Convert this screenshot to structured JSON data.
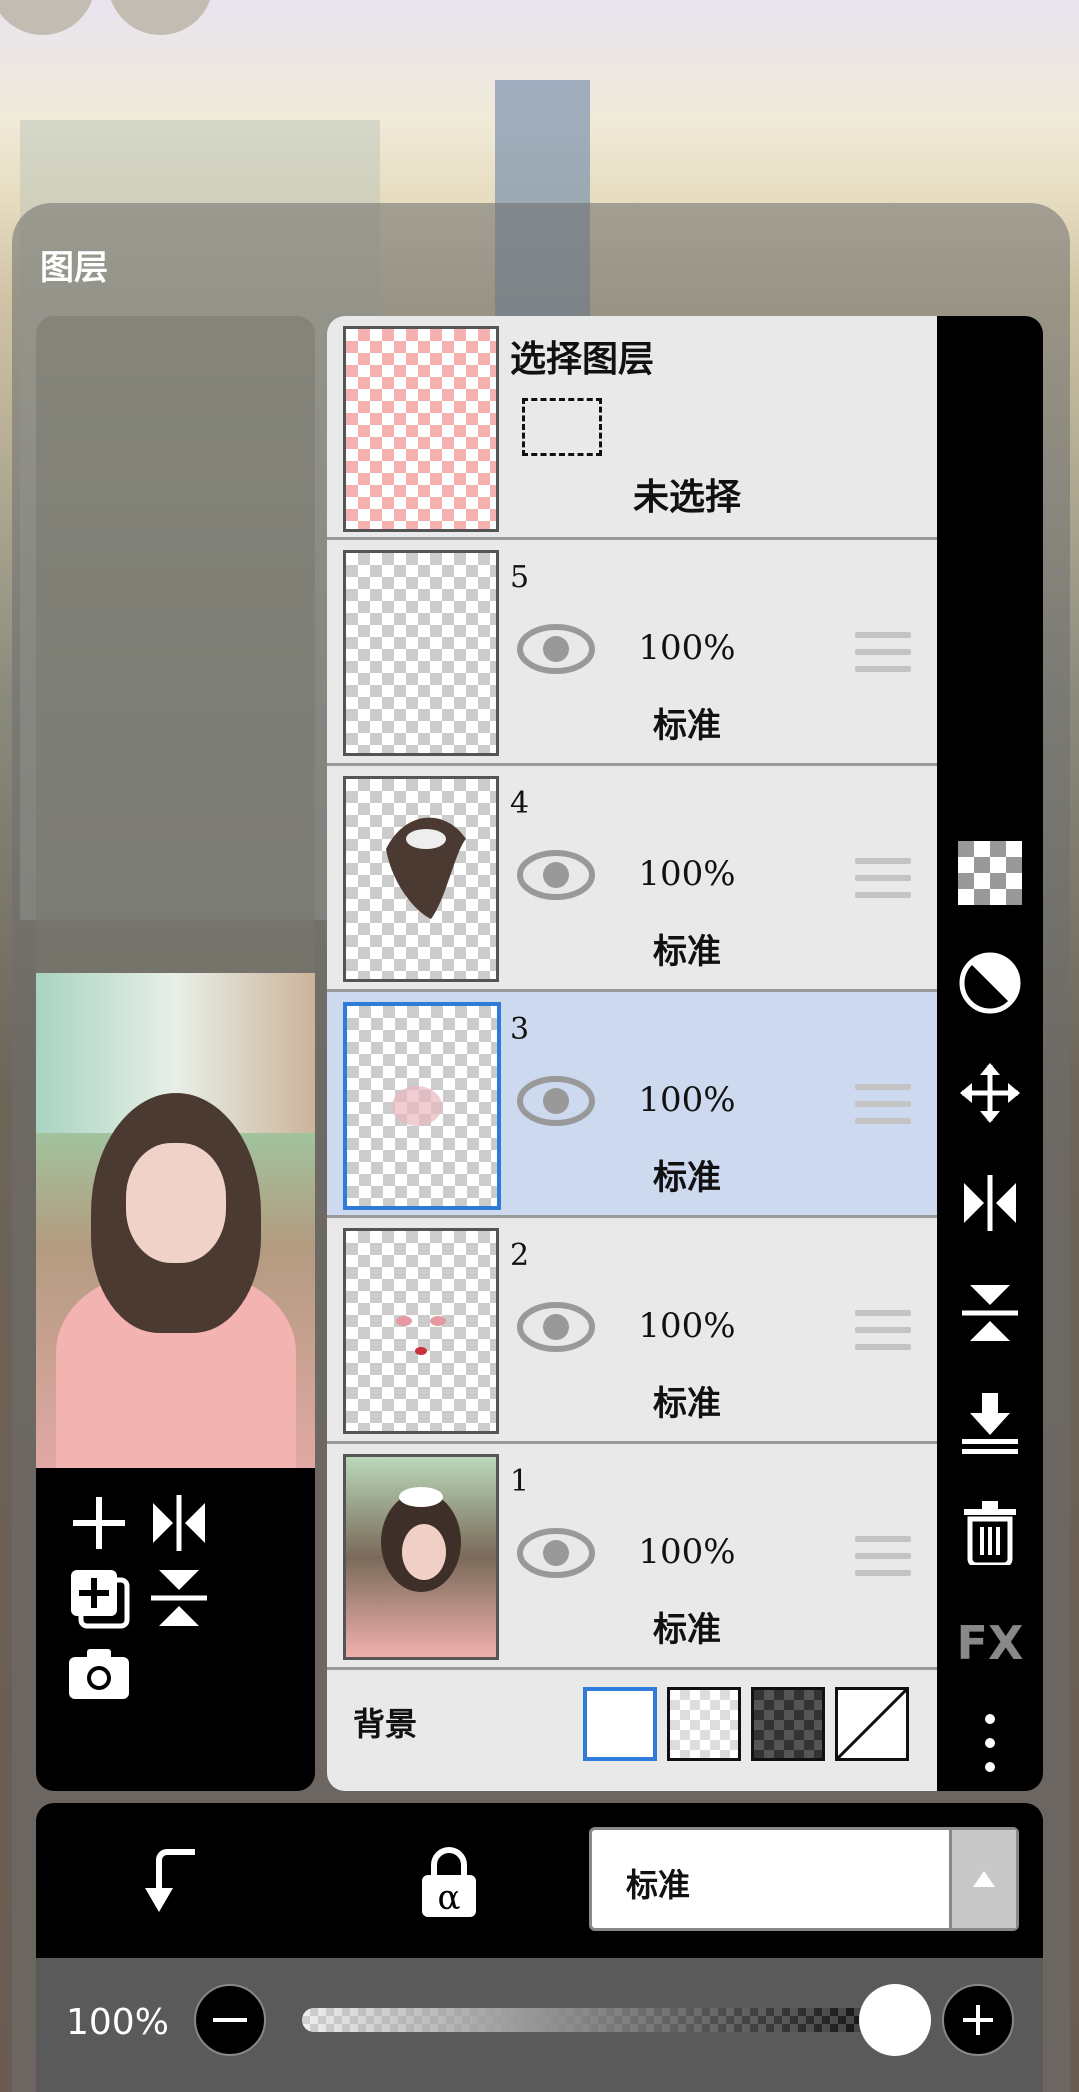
{
  "panel": {
    "title": "图层"
  },
  "selection_layer": {
    "title": "选择图层",
    "status": "未选择"
  },
  "layers": [
    {
      "number": "5",
      "opacity": "100%",
      "blend": "标准"
    },
    {
      "number": "4",
      "opacity": "100%",
      "blend": "标准"
    },
    {
      "number": "3",
      "opacity": "100%",
      "blend": "标准",
      "selected": true
    },
    {
      "number": "2",
      "opacity": "100%",
      "blend": "标准"
    },
    {
      "number": "1",
      "opacity": "100%",
      "blend": "标准"
    }
  ],
  "background": {
    "label": "背景",
    "options": [
      "white",
      "transparent",
      "dark-checker",
      "none"
    ],
    "selected": "white"
  },
  "bottom": {
    "blend_mode": "标准"
  },
  "opacity_slider": {
    "label": "100%",
    "value": 1.0
  },
  "right_tools": [
    "checker-icon",
    "contrast-icon",
    "move-icon",
    "flip-horizontal-icon",
    "flip-vertical-icon",
    "merge-down-icon",
    "trash-icon",
    "fx-icon",
    "more-icon"
  ],
  "right_tools_fx_label": "FX",
  "colors": {
    "accent": "#2f7bd8",
    "selected_row": "#ccd9ee",
    "panel_black": "#000000"
  }
}
